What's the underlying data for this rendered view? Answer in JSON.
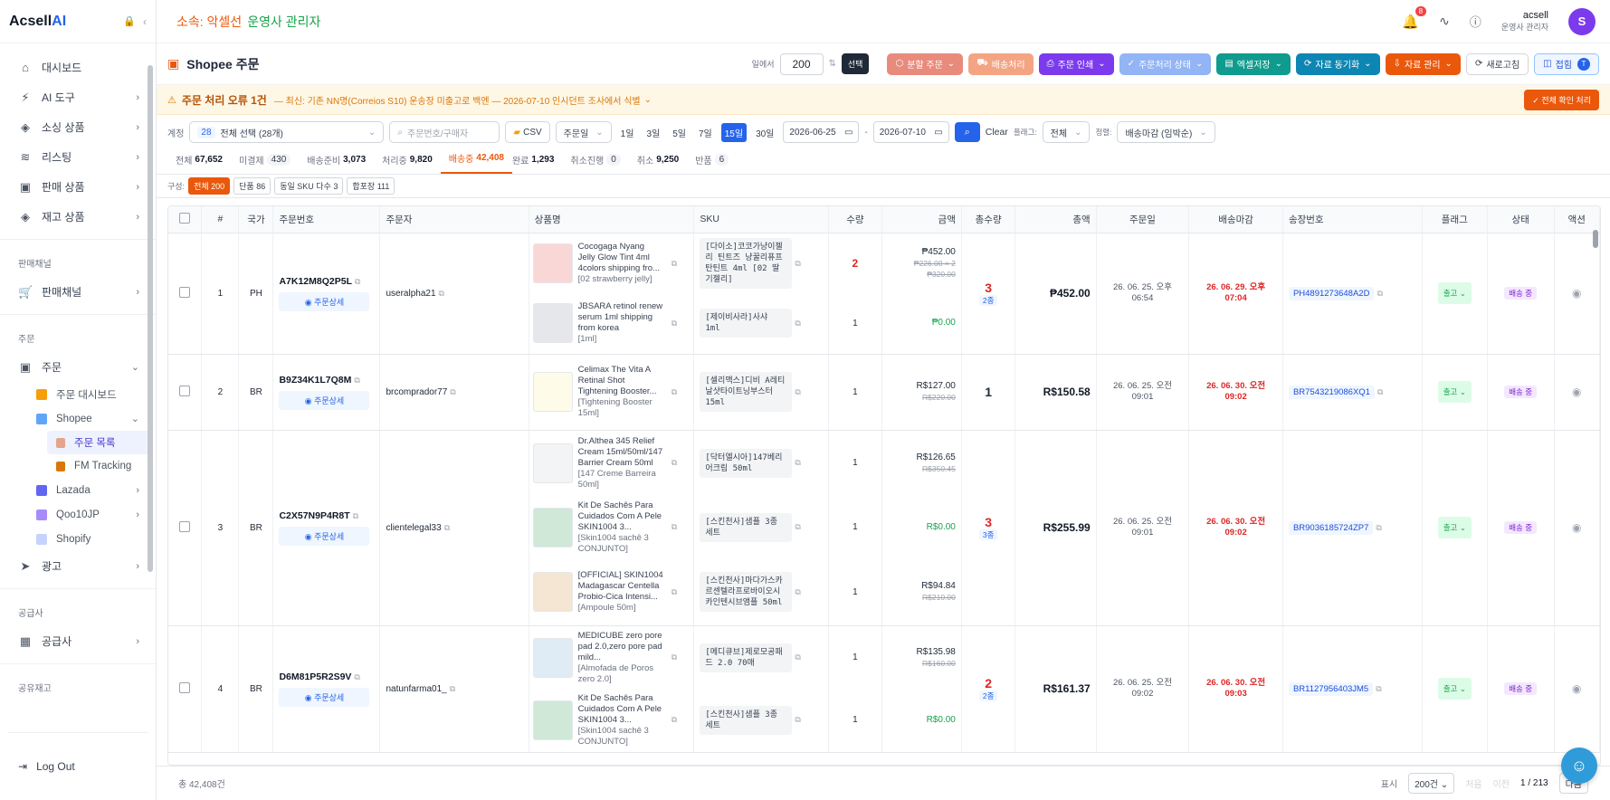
{
  "brand": {
    "name_prefix": "Acsell",
    "name_suffix": "AI"
  },
  "sidebar": {
    "items": [
      {
        "label": "대시보드",
        "icon": "home-icon"
      },
      {
        "label": "AI 도구",
        "icon": "sparkle-icon"
      },
      {
        "label": "소싱 상품",
        "icon": "box-icon"
      },
      {
        "label": "리스팅",
        "icon": "layers-icon"
      },
      {
        "label": "판매 상품",
        "icon": "store-icon"
      },
      {
        "label": "재고 상품",
        "icon": "cube-icon"
      }
    ],
    "section_channels": "판매채널",
    "channels_item": "판매채널",
    "section_orders": "주문",
    "orders_item": "주문",
    "orders_sub": {
      "dashboard": "주문 대시보드",
      "shopee": "Shopee",
      "order_list": "주문 목록",
      "fm_tracking": "FM Tracking",
      "lazada": "Lazada",
      "qoo10": "Qoo10JP",
      "shopify": "Shopify"
    },
    "ads": "광고",
    "section_supplier": "공급사",
    "supplier_item": "공급사",
    "section_shared": "공유재고",
    "logout": "Log Out"
  },
  "topbar": {
    "affiliation_label": "소속: 악셀선",
    "affiliation_role": "운영사 관리자",
    "notif_count": "8",
    "user_name": "acsell",
    "user_role": "운영사 관리자",
    "avatar": "S"
  },
  "page": {
    "title": "Shopee 주문",
    "limit_label": "일에서",
    "limit_value": "200",
    "select_btn": "선택",
    "buttons": {
      "split": "분할 주문",
      "ship": "배송처리",
      "print": "주문 인쇄",
      "status": "주문처리 상태",
      "excel": "엑셀저장",
      "sync": "자료 동기화",
      "manage": "자료 관리",
      "refresh": "새로고침",
      "fold": "접힘",
      "fold_count": "T"
    }
  },
  "alert": {
    "title": "주문 처리 오류 1건",
    "detail": "— 최신: 기존 NN명(Correios S10) 운송장 미출고로 백엔 — 2026-07-10 인시던트 조사에서 식별",
    "confirm": "전체 확인 처리"
  },
  "filters": {
    "account_label": "계정",
    "account_count": "28",
    "account_value": "전체 선택 (28개)",
    "search_placeholder": "주문번호/구매자",
    "csv": "CSV",
    "date_type": "주문일",
    "ranges": [
      "1일",
      "3일",
      "5일",
      "7일",
      "15일",
      "30일"
    ],
    "active_range": "15일",
    "date_from": "2026-06-25",
    "date_to": "2026-07-10",
    "clear": "Clear",
    "flag_label": "플래그:",
    "flag_value": "전체",
    "sort_label": "정렬:",
    "sort_value": "배송마감 (임박순)"
  },
  "stats": [
    {
      "label": "전체",
      "value": "67,652",
      "style": "plain"
    },
    {
      "label": "미결제",
      "value": "430",
      "style": "pill"
    },
    {
      "label": "배송준비",
      "value": "3,073",
      "style": "plain"
    },
    {
      "label": "처리중",
      "value": "9,820",
      "style": "plain"
    },
    {
      "label": "배송중",
      "value": "42,408",
      "style": "on"
    },
    {
      "label": "완료",
      "value": "1,293",
      "style": "plain"
    },
    {
      "label": "취소진행",
      "value": "0",
      "style": "pill"
    },
    {
      "label": "취소",
      "value": "9,250",
      "style": "plain"
    },
    {
      "label": "반품",
      "value": "6",
      "style": "pill"
    }
  ],
  "composition": {
    "label": "구성:",
    "tags": [
      {
        "label": "전체 200",
        "on": true
      },
      {
        "label": "단품 86",
        "on": false
      },
      {
        "label": "동일 SKU 다수 3",
        "on": false
      },
      {
        "label": "합포장 111",
        "on": false
      }
    ]
  },
  "table": {
    "headers": [
      "#",
      "국가",
      "주문번호",
      "주문자",
      "상품명",
      "SKU",
      "수량",
      "금액",
      "총수량",
      "총액",
      "주문일",
      "배송마감",
      "송장번호",
      "플래그",
      "상태",
      "액션"
    ],
    "detail_label": "주문상세",
    "rows": [
      {
        "num": "1",
        "country": "PH",
        "order_no": "A7K12M8Q2P5L",
        "buyer": "useralpha21",
        "items": [
          {
            "name": "Cocogaga Nyang Jelly Glow Tint 4ml 4colors shipping fro...",
            "opt": "[02 strawberry jelly]",
            "sku": "[다이소]코코가냥이젤리 틴트즈 냥꿀리퓨프탄틴트 4ml [02 딸기젤리]",
            "qty": "2",
            "qty_red": true,
            "amount": "₱452.00",
            "sub1": "₱226.00 × 2",
            "sub2": "₱320.00"
          },
          {
            "name": "JBSARA retinol renew serum 1ml shipping from korea",
            "opt": "[1ml]",
            "sku": "[제이비사라]사샤 1ml",
            "qty": "1",
            "qty_red": false,
            "amount": "₱0.00",
            "green": true
          }
        ],
        "total_qty": "3",
        "total_kinds": "2종",
        "total_red": true,
        "total": "₱452.00",
        "order_date": "26. 06. 25. 오후 06:54",
        "deadline": "26. 06. 29. 오후 07:04",
        "tracking": "PH4891273648A2D",
        "flag": "출고",
        "status": "배송 중"
      },
      {
        "num": "2",
        "country": "BR",
        "order_no": "B9Z34K1L7Q8M",
        "buyer": "brcomprador77",
        "items": [
          {
            "name": "Celimax The Vita A Retinal Shot Tightening Booster...",
            "opt": "[Tightening Booster 15ml]",
            "sku": "[셀리맥스]디비 A레티날샷타이트닝부스터 15ml",
            "qty": "1",
            "qty_red": false,
            "amount": "R$127.00",
            "sub2": "R$220.00"
          }
        ],
        "total_qty": "1",
        "total_kinds": "",
        "total_red": false,
        "total": "R$150.58",
        "order_date": "26. 06. 25. 오전 09:01",
        "deadline": "26. 06. 30. 오전 09:02",
        "tracking": "BR7543219086XQ1",
        "flag": "출고",
        "status": "배송 중"
      },
      {
        "num": "3",
        "country": "BR",
        "order_no": "C2X57N9P4R8T",
        "buyer": "clientelegal33",
        "items": [
          {
            "name": "Dr.Althea 345 Relief Cream 15ml/50ml/147 Barrier Cream 50ml",
            "opt": "[147 Creme Barreira 50ml]",
            "sku": "[닥터엘시아]147베리어크림 50ml",
            "qty": "1",
            "qty_red": false,
            "amount": "R$126.65",
            "sub2": "R$350.45"
          },
          {
            "name": "Kit De Sachês Para Cuidados Com A Pele SKIN1004 3...",
            "opt": "[Skin1004 sachê 3 CONJUNTO]",
            "sku": "[스킨천사]샘플 3종 세트",
            "qty": "1",
            "qty_red": false,
            "amount": "R$0.00",
            "green": true
          },
          {
            "name": "[OFFICIAL] SKIN1004 Madagascar Centella Probio-Cica Intensi...",
            "opt": "[Ampoule 50m]",
            "sku": "[스킨천사]마다가스카르센텔라프로바이오시카인텐시브앰플 50ml",
            "qty": "1",
            "qty_red": false,
            "amount": "R$94.84",
            "sub2": "R$210.00"
          }
        ],
        "total_qty": "3",
        "total_kinds": "3종",
        "total_red": true,
        "total": "R$255.99",
        "order_date": "26. 06. 25. 오전 09:01",
        "deadline": "26. 06. 30. 오전 09:02",
        "tracking": "BR9036185724ZP7",
        "flag": "출고",
        "status": "배송 중"
      },
      {
        "num": "4",
        "country": "BR",
        "order_no": "D6M81P5R2S9V",
        "buyer": "natunfarma01_",
        "items": [
          {
            "name": "MEDICUBE zero pore pad 2.0,zero pore pad mild...",
            "opt": "[Almofada de Poros zero 2.0]",
            "sku": "[메디큐브]제로모공패드 2.0 70매",
            "qty": "1",
            "qty_red": false,
            "amount": "R$135.98",
            "sub2": "R$160.00"
          },
          {
            "name": "Kit De Sachês Para Cuidados Com A Pele SKIN1004 3...",
            "opt": "[Skin1004 sachê 3 CONJUNTO]",
            "sku": "[스킨천사]샘플 3종 세트",
            "qty": "1",
            "qty_red": false,
            "amount": "R$0.00",
            "green": true
          }
        ],
        "total_qty": "2",
        "total_kinds": "2종",
        "total_red": true,
        "total": "R$161.37",
        "order_date": "26. 06. 25. 오전 09:02",
        "deadline": "26. 06. 30. 오전 09:03",
        "tracking": "BR1127956403JM5",
        "flag": "출고",
        "status": "배송 중"
      }
    ]
  },
  "footer": {
    "total": "총 42,408건",
    "display_label": "표시",
    "per_page": "200건",
    "prev": "처음",
    "prev2": "이전",
    "page": "1 / 213",
    "next": "다음"
  },
  "colors": {
    "accent": "#2563eb",
    "orange": "#ea580c",
    "purple": "#7c3aed"
  }
}
